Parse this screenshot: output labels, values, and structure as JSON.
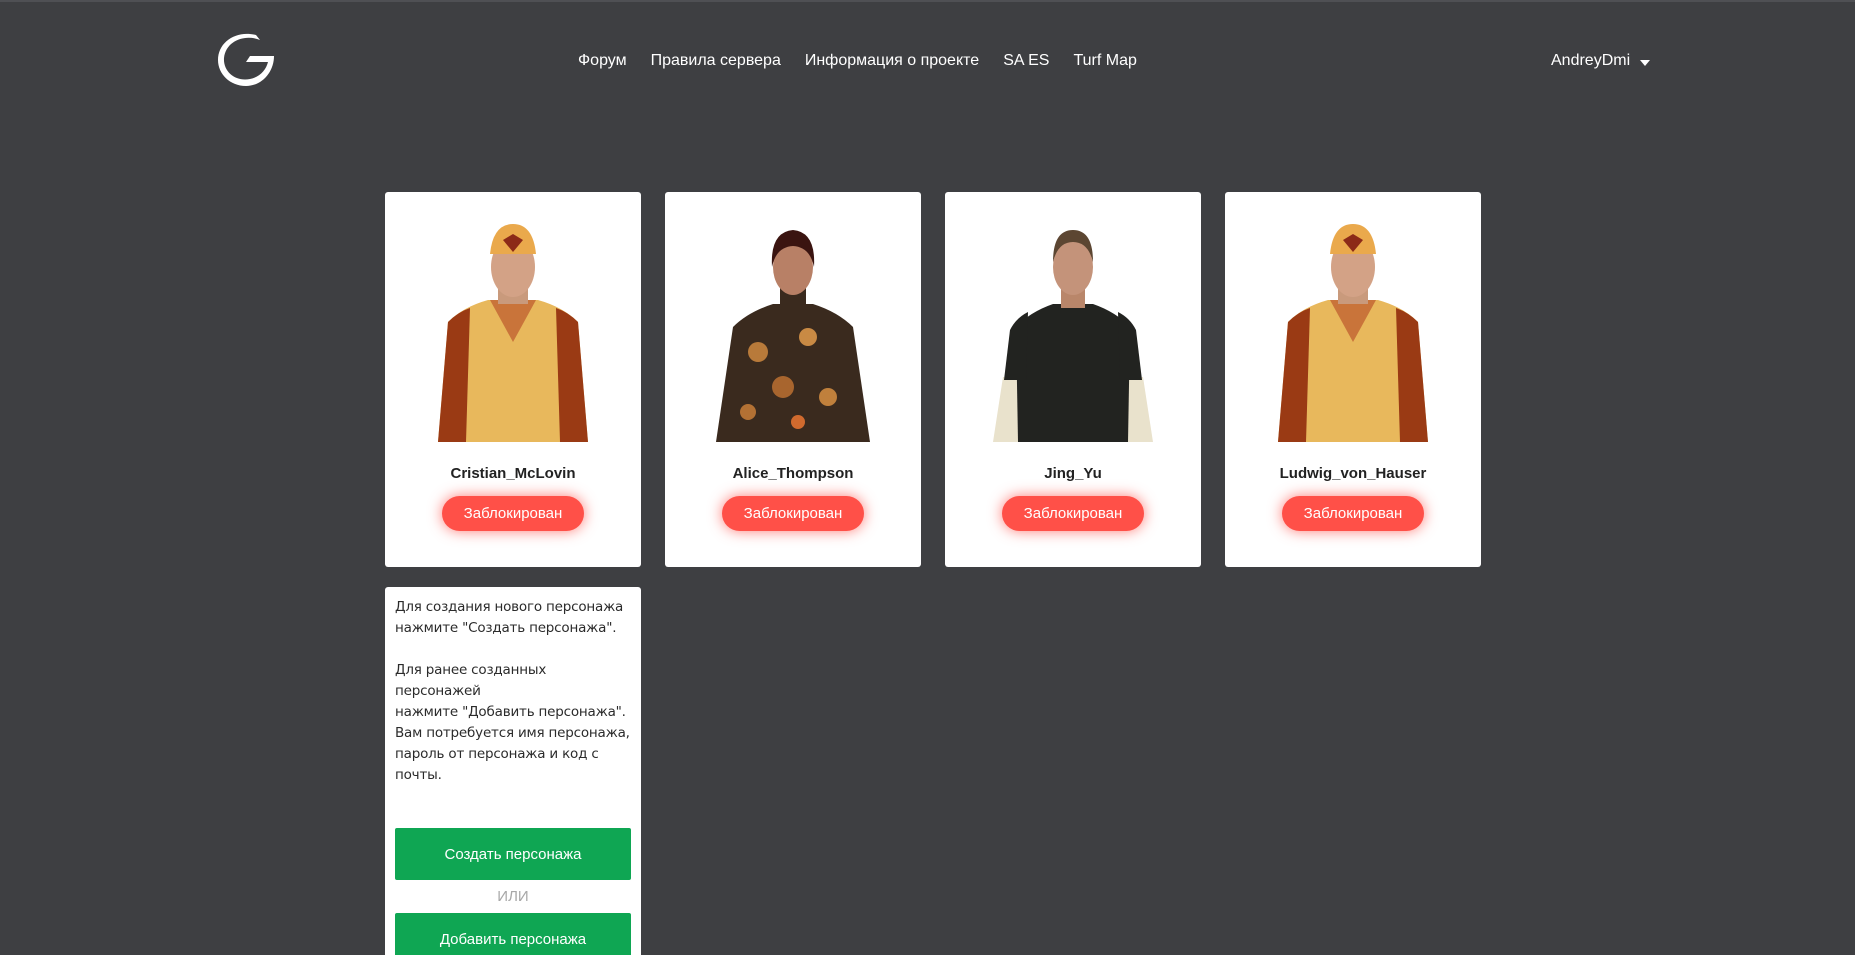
{
  "nav": {
    "links": [
      "Форум",
      "Правила сервера",
      "Информация о проекте",
      "SA ES",
      "Turf Map"
    ]
  },
  "user": {
    "name": "AndreyDmi"
  },
  "characters": [
    {
      "name": "Cristian_McLovin",
      "status": "Заблокирован",
      "skin": "yellow-uniform"
    },
    {
      "name": "Alice_Thompson",
      "status": "Заблокирован",
      "skin": "floral-dress"
    },
    {
      "name": "Jing_Yu",
      "status": "Заблокирован",
      "skin": "black-shirt"
    },
    {
      "name": "Ludwig_von_Hauser",
      "status": "Заблокирован",
      "skin": "yellow-uniform"
    }
  ],
  "info": {
    "create_text": "Для создания нового персонажа\nнажмите \"Создать персонажа\".",
    "add_text": "Для ранее созданных персонажей\nнажмите \"Добавить персонажа\".\nВам потребуется имя персонажа,\nпароль от персонажа и код с\nпочты.",
    "create_button": "Создать персонажа",
    "or_label": "ИЛИ",
    "add_button": "Добавить персонажа"
  },
  "colors": {
    "background": "#3e3f42",
    "blocked": "#ff5048",
    "action": "#0fa653"
  }
}
